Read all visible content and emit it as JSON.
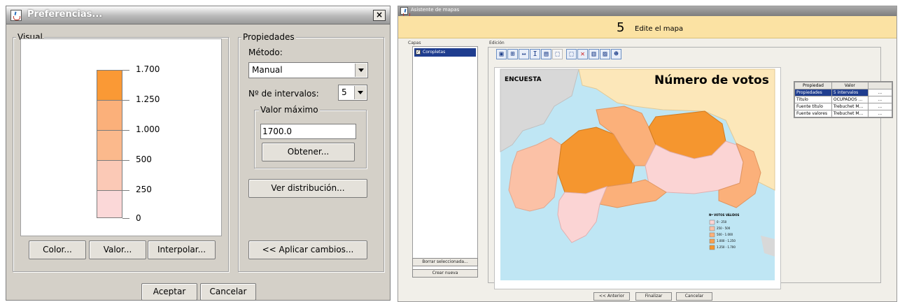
{
  "prefs_dialog": {
    "title": "Preferencias...",
    "close_glyph": "×",
    "visual_group": "Visual",
    "properties_group": "Propiedades",
    "method_label": "Método:",
    "method_value": "Manual",
    "intervals_label": "Nº de intervalos:",
    "intervals_value": "5",
    "max_group": "Valor máximo",
    "max_value": "1700.0",
    "obtain_button": "Obtener...",
    "distribution_button": "Ver distribución...",
    "color_button": "Color...",
    "value_button": "Valor...",
    "interpolate_button": "Interpolar...",
    "apply_button": "<< Aplicar cambios...",
    "accept_button": "Aceptar",
    "cancel_button": "Cancelar",
    "legend": {
      "labels": [
        "1.700",
        "1.250",
        "1.000",
        "500",
        "250",
        "0"
      ],
      "colors": [
        "#fa9935",
        "#fbb07a",
        "#fbb98c",
        "#fbc9b6",
        "#fbd8d8"
      ]
    }
  },
  "wizard": {
    "title": "Asistente de mapas",
    "step_number": "5",
    "step_title": "Edite el mapa",
    "layers_label": "Capas",
    "layer_item": "Coropletas",
    "edit_label": "Edición",
    "delete_button": "Borrar seleccionada...",
    "new_button": "Crear nueva",
    "back_button": "<< Anterior",
    "finish_button": "Finalizar",
    "cancel_button": "Cancelar",
    "toolbar_glyphs": [
      "▣",
      "⊞",
      "↔",
      "I",
      "▤",
      "⬚",
      "⬚",
      "✕",
      "▥",
      "▨",
      "☻"
    ],
    "map": {
      "survey_label": "ENCUESTA",
      "map_title": "Número de votos",
      "legend_title": "Nº VOTOS VÁLIDOS",
      "legend_items": [
        "0 - 250",
        "250 - 500",
        "500 - 1.000",
        "1.000 - 1.250",
        "1.250 - 1.700"
      ]
    },
    "properties_table": {
      "headers": [
        "Propiedad",
        "Valor"
      ],
      "rows": [
        [
          "Propiedades",
          "5 intervalos"
        ],
        [
          "Título",
          "OCUPADOS ..."
        ],
        [
          "Fuente título",
          "Trebuchet M..."
        ],
        [
          "Fuente valores",
          "Trebuchet M..."
        ]
      ]
    },
    "colors": {
      "sea": "#bfe6f4",
      "land_gray": "#d8d8d8",
      "land_beige": "#fce7b9",
      "dark": "#f5962f",
      "mid": "#fbb07a",
      "light": "#fbc1a6",
      "pale": "#fbd4d4"
    }
  }
}
